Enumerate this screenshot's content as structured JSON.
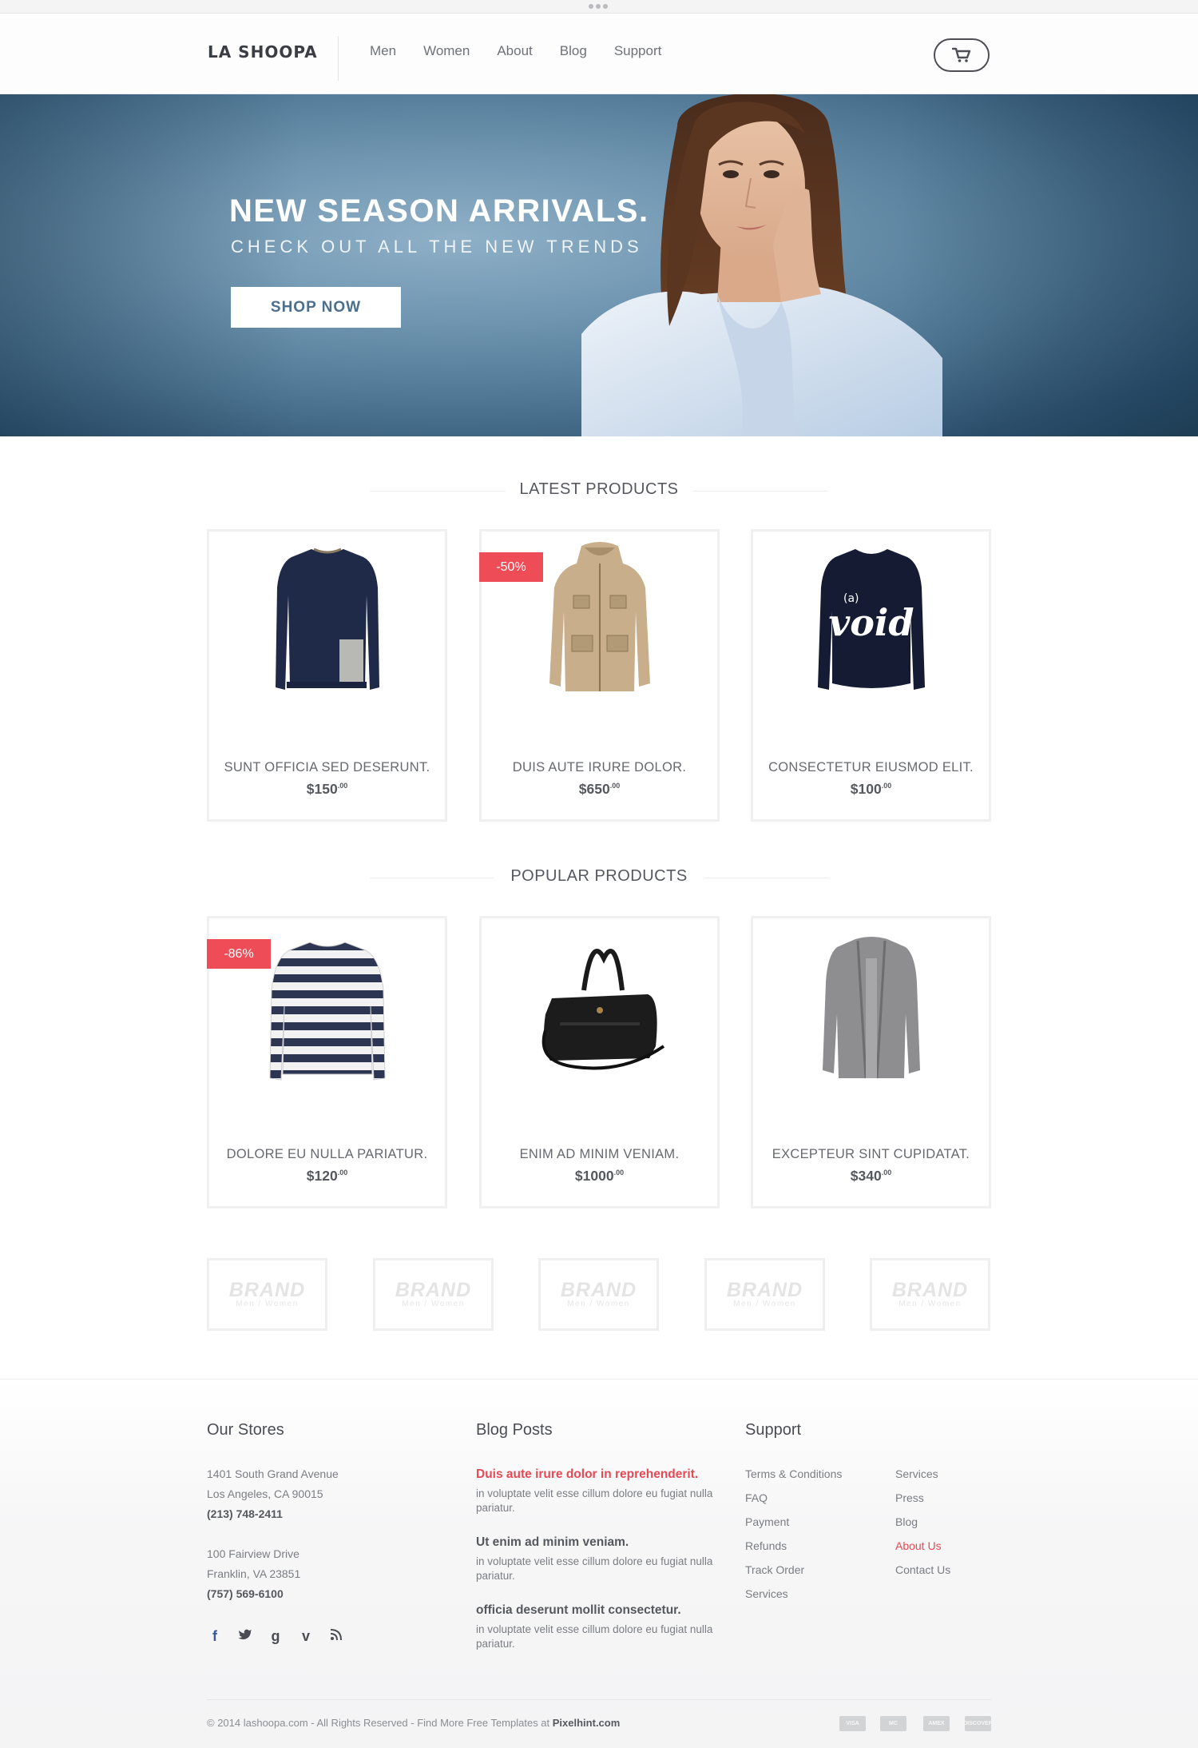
{
  "brand": {
    "logo": "LA SHOOPA"
  },
  "nav": {
    "items": [
      "Men",
      "Women",
      "About",
      "Blog",
      "Support"
    ]
  },
  "hero": {
    "title": "NEW SEASON ARRIVALS.",
    "subtitle": "CHECK OUT ALL THE NEW TRENDS",
    "cta": "SHOP NOW"
  },
  "latest": {
    "title": "LATEST PRODUCTS",
    "products": [
      {
        "name": "SUNT OFFICIA SED DESERUNT.",
        "price": "$150",
        "cents": ".00",
        "badge": "",
        "icon": "navy-sweater-icon"
      },
      {
        "name": "DUIS AUTE IRURE DOLOR.",
        "price": "$650",
        "cents": ".00",
        "badge": "-50%",
        "icon": "parka-jacket-icon"
      },
      {
        "name": "CONSECTETUR EIUSMOD ELIT.",
        "price": "$100",
        "cents": ".00",
        "badge": "",
        "icon": "void-sweater-icon"
      }
    ]
  },
  "popular": {
    "title": "POPULAR PRODUCTS",
    "products": [
      {
        "name": "DOLORE EU NULLA PARIATUR.",
        "price": "$120",
        "cents": ".00",
        "badge": "-86%",
        "icon": "striped-top-icon"
      },
      {
        "name": "ENIM AD MINIM VENIAM.",
        "price": "$1000",
        "cents": ".00",
        "badge": "",
        "icon": "leather-bag-icon"
      },
      {
        "name": "EXCEPTEUR SINT CUPIDATAT.",
        "price": "$340",
        "cents": ".00",
        "badge": "",
        "icon": "grey-cardigan-icon"
      }
    ]
  },
  "brands": [
    {
      "name": "BRAND",
      "tag": "Men / Women"
    },
    {
      "name": "BRAND",
      "tag": "Men / Women"
    },
    {
      "name": "BRAND",
      "tag": "Men / Women"
    },
    {
      "name": "BRAND",
      "tag": "Men / Women"
    },
    {
      "name": "BRAND",
      "tag": "Men / Women"
    }
  ],
  "footer": {
    "stores": {
      "title": "Our Stores",
      "store1": [
        "1401 South Grand Avenue",
        "Los Angeles, CA 90015",
        "(213) 748-2411"
      ],
      "store2": [
        "100 Fairview Drive",
        "Franklin, VA 23851",
        "(757) 569-6100"
      ]
    },
    "blog": {
      "title": "Blog Posts",
      "posts": [
        {
          "title": "Duis aute irure dolor in reprehenderit.",
          "text": " in voluptate velit esse cillum dolore eu fugiat nulla pariatur."
        },
        {
          "title": "Ut enim ad minim veniam.",
          "text": " in voluptate velit esse cillum dolore eu fugiat nulla pariatur."
        },
        {
          "title": "officia deserunt mollit consectetur.",
          "text": " in voluptate velit esse cillum dolore eu fugiat nulla pariatur."
        }
      ]
    },
    "support": {
      "title": "Support",
      "col1": [
        "Terms & Conditions",
        "FAQ",
        "Payment",
        "Refunds",
        "Track Order",
        "Services"
      ],
      "col2": [
        "Services",
        "Press",
        "Blog",
        "About Us",
        "Contact Us"
      ]
    },
    "social": [
      "facebook-icon",
      "twitter-icon",
      "google-icon",
      "vimeo-icon",
      "rss-icon"
    ],
    "copyright": "© 2014 lashoopa.com  -  All Rights Reserved  -  Find More Free Templates at ",
    "copyright_link": "Pixelhint.com",
    "payments": [
      "VISA",
      "MC",
      "AMEX",
      "DISCOVER"
    ]
  },
  "colors": {
    "accent": "#ee4d58",
    "hero_blue": "#4f7794",
    "text": "#55585d"
  }
}
